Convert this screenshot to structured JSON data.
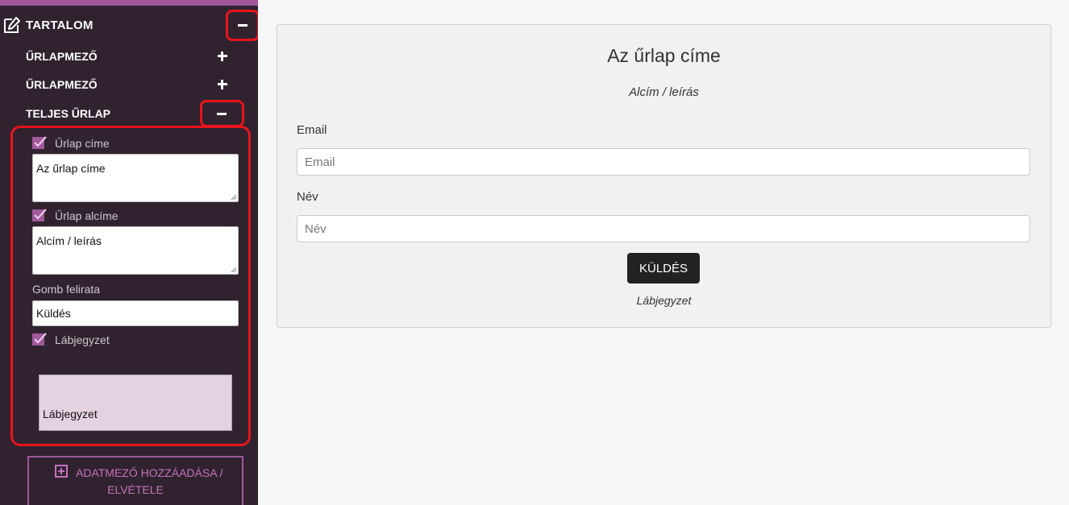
{
  "sidebar": {
    "section_title": "TARTALOM",
    "items": [
      {
        "label": "ŰRLAPMEZŐ"
      },
      {
        "label": "ŰRLAPMEZŐ"
      },
      {
        "label": "TELJES ŰRLAP"
      }
    ],
    "full_form": {
      "title_label": "Űrlap címe",
      "title_value": "Az űrlap címe",
      "subtitle_label": "Űrlap alcíme",
      "subtitle_value": "Alcím / leírás",
      "button_label_caption": "Gomb felirata",
      "button_label_value": "Küldés",
      "footer_label": "Lábjegyzet",
      "footer_value": "Lábjegyzet"
    },
    "add_button_line1": "ADATMEZŐ HOZZÁADÁSA /",
    "add_button_line2": "ELVÉTELE"
  },
  "preview": {
    "title": "Az űrlap címe",
    "subtitle": "Alcím / leírás",
    "email_label": "Email",
    "email_placeholder": "Email",
    "name_label": "Név",
    "name_placeholder": "Név",
    "submit_label": "KÜLDÉS",
    "footer": "Lábjegyzet"
  },
  "colors": {
    "sidebar_bg": "#30232f",
    "accent": "#a0589b",
    "highlight": "#e8141b",
    "button_bg": "#222222"
  }
}
